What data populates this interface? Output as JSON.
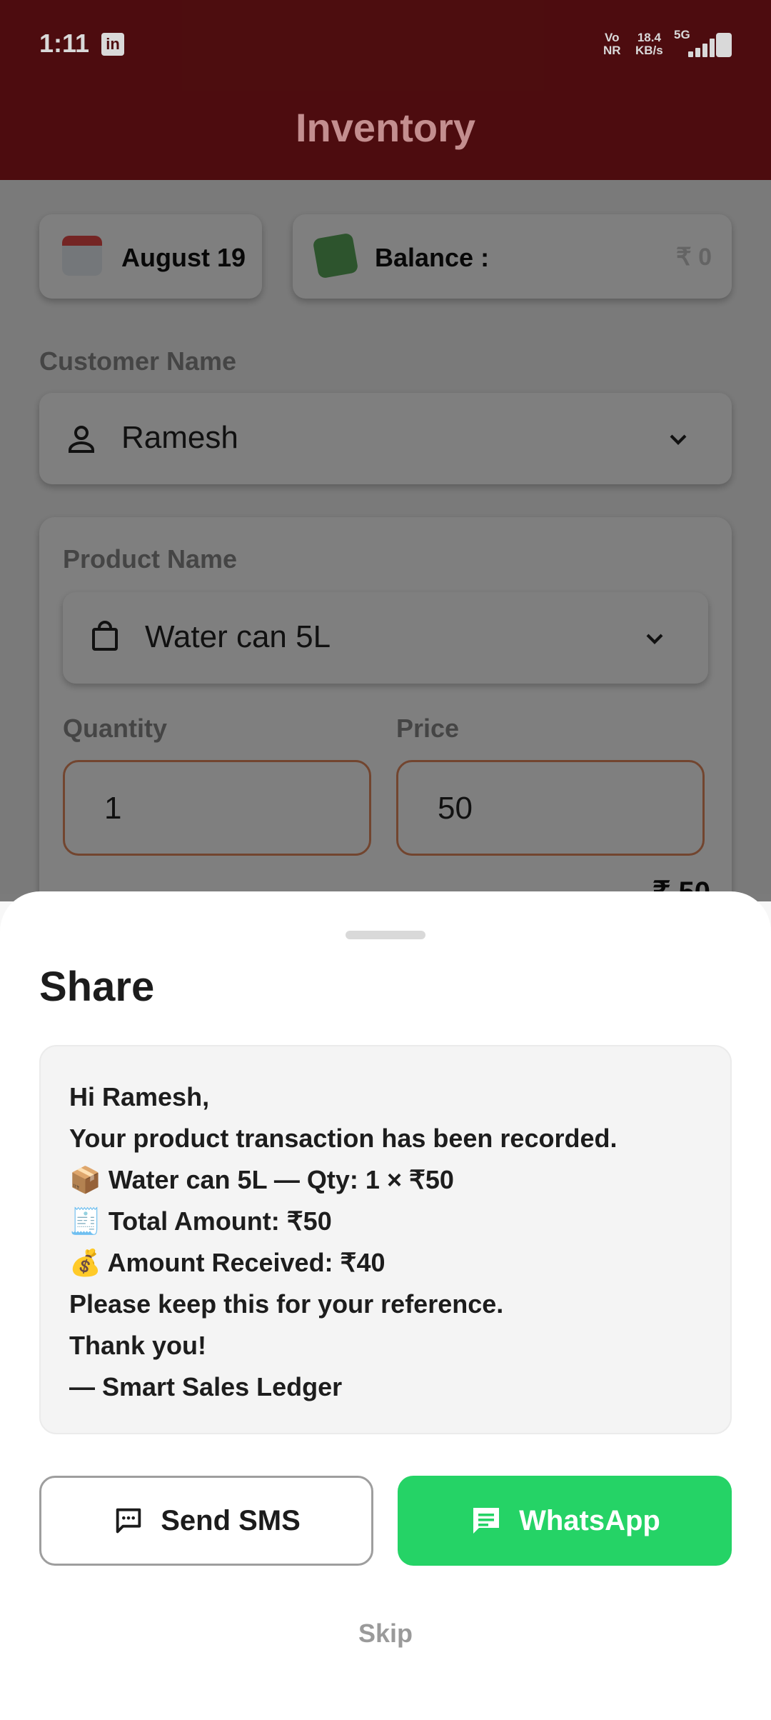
{
  "status_bar": {
    "time": "1:11",
    "vonr_top": "Vo",
    "vonr_bottom": "NR",
    "speed_value": "18.4",
    "speed_unit": "KB/s",
    "network": "5G"
  },
  "header": {
    "title": "Inventory"
  },
  "summary": {
    "date": "August 19",
    "balance_label": "Balance :",
    "balance_value": "₹ 0"
  },
  "customer": {
    "label": "Customer Name",
    "value": "Ramesh"
  },
  "product": {
    "label": "Product Name",
    "value": "Water can 5L",
    "quantity_label": "Quantity",
    "quantity_value": "1",
    "price_label": "Price",
    "price_value": "50",
    "total_peek": "₹ 50"
  },
  "share_sheet": {
    "title": "Share",
    "message_lines": [
      "Hi Ramesh,",
      "Your product transaction has been recorded.",
      "📦 Water can 5L — Qty: 1 × ₹50",
      "🧾 Total Amount: ₹50",
      "💰 Amount Received: ₹40",
      "Please keep this for your reference.",
      "Thank you!",
      "— Smart Sales Ledger"
    ],
    "sms_label": "Send SMS",
    "whatsapp_label": "WhatsApp",
    "skip_label": "Skip"
  },
  "colors": {
    "header_bg": "#5b0f12",
    "whatsapp": "#25d366",
    "input_border": "#e58b5f"
  }
}
